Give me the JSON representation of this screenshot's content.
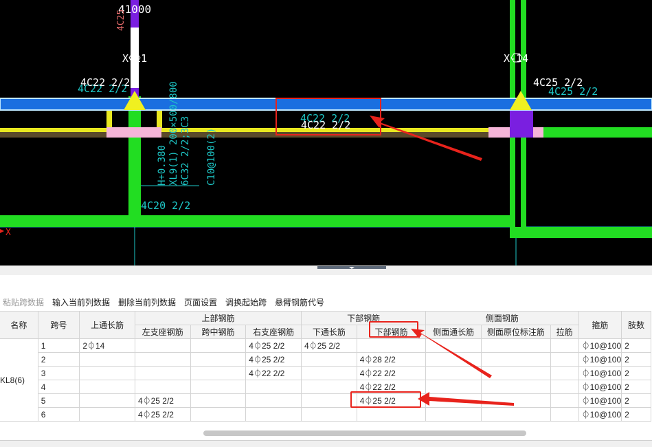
{
  "cad": {
    "label_top": "41000",
    "label_top_rot": "4C25",
    "axis_left": "X-11",
    "axis_right": "X-14",
    "axis_x": "X",
    "rebar_left_white": "4C22 2/2",
    "rebar_left_cyan": "4C22 2/2",
    "rebar_right_white": "4C25 2/2",
    "rebar_right_cyan": "4C25 2/2",
    "rebar_mid_cyan": "4C22 2/2",
    "rebar_mid_white": "4C22 2/2",
    "rebar_low": "4C20 2/2",
    "vert_1": "H+0.380",
    "vert_2": "XL9(1) 200×500/800",
    "vert_3": "6C32 2/2;3C3",
    "vert_4": "C10@100(2)"
  },
  "toolbar": {
    "paste": "粘贴跨数据",
    "input_col": "输入当前列数据",
    "delete_col": "删除当前列数据",
    "page_setup": "页面设置",
    "swap_start": "调换起始跨",
    "cantilever": "悬臂钢筋代号"
  },
  "table": {
    "headers": {
      "name": "名称",
      "span": "跨号",
      "top_through": "上通长筋",
      "top_group": "上部钢筋",
      "bottom_group": "下部钢筋",
      "side_group": "侧面钢筋",
      "stirrup": "箍筋",
      "limb": "肢数",
      "left_support": "左支座钢筋",
      "mid_span": "跨中钢筋",
      "right_support": "右支座钢筋",
      "bottom_through": "下通长筋",
      "bottom_rebar": "下部钢筋",
      "side_through": "侧面通长筋",
      "side_in_situ": "侧面原位标注筋",
      "tie": "拉筋"
    },
    "beam_name": "KL8(6)",
    "rows": [
      {
        "span": "1",
        "top_through": "2⏀14",
        "left": "",
        "mid": "",
        "right": "4⏀25 2/2",
        "bot_through": "4⏀25 2/2",
        "bottom": "",
        "side_through": "",
        "side_insitu": "",
        "tie": "",
        "stirrup": "⏀10@100",
        "limb": "2"
      },
      {
        "span": "2",
        "top_through": "",
        "left": "",
        "mid": "",
        "right": "4⏀25 2/2",
        "bot_through": "",
        "bottom": "4⏀28 2/2",
        "side_through": "",
        "side_insitu": "",
        "tie": "",
        "stirrup": "⏀10@100",
        "limb": "2"
      },
      {
        "span": "3",
        "top_through": "",
        "left": "",
        "mid": "",
        "right": "4⏀22 2/2",
        "bot_through": "",
        "bottom": "4⏀22 2/2",
        "side_through": "",
        "side_insitu": "",
        "tie": "",
        "stirrup": "⏀10@100",
        "limb": "2"
      },
      {
        "span": "4",
        "top_through": "",
        "left": "",
        "mid": "",
        "right": "",
        "bot_through": "",
        "bottom": "4⏀22 2/2",
        "side_through": "",
        "side_insitu": "",
        "tie": "",
        "stirrup": "⏀10@100",
        "limb": "2"
      },
      {
        "span": "5",
        "top_through": "",
        "left": "4⏀25 2/2",
        "mid": "",
        "right": "",
        "bot_through": "",
        "bottom": "4⏀25 2/2",
        "side_through": "",
        "side_insitu": "",
        "tie": "",
        "stirrup": "⏀10@100",
        "limb": "2"
      },
      {
        "span": "6",
        "top_through": "",
        "left": "4⏀25 2/2",
        "mid": "",
        "right": "",
        "bot_through": "",
        "bottom": "",
        "side_through": "",
        "side_insitu": "",
        "tie": "",
        "stirrup": "⏀10@100",
        "limb": "2"
      }
    ]
  },
  "colors": {
    "beam_blue": "#1a6fe0",
    "column_green": "#22dd22",
    "annotation_red": "#e8231c",
    "cad_cyan": "#1ec8c8"
  }
}
